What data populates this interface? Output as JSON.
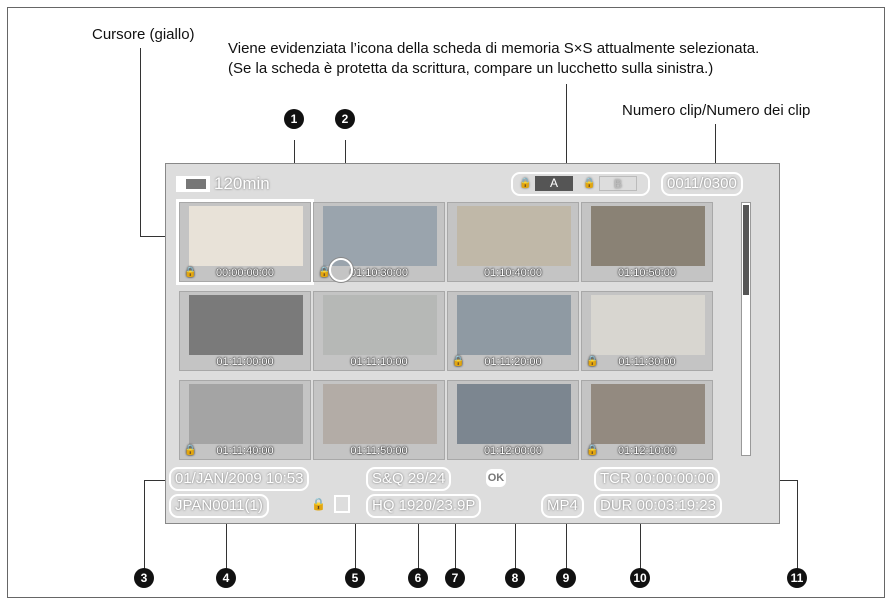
{
  "annotations": {
    "cursor": "Cursore (giallo)",
    "card_line1": "Viene evidenziata l’icona della scheda di memoria S×S attualmente selezionata.",
    "card_line2": "(Se la scheda è protetta da scrittura, compare un lucchetto sulla sinistra.)",
    "clip_count": "Numero clip/Numero dei clip"
  },
  "callouts": [
    "1",
    "2",
    "3",
    "4",
    "5",
    "6",
    "7",
    "8",
    "9",
    "10",
    "11"
  ],
  "screen": {
    "battery": "120min",
    "slot_a": "A",
    "slot_b": "B",
    "clip_counter": "0011/0300",
    "date": "01/JAN/2009 10:53",
    "clip_name": "JPAN0011(1)",
    "sq": "S&Q 29/24",
    "ok": "OK",
    "format": "HQ 1920/23.9P",
    "file_type": "MP4",
    "tcr": "TCR 00:00:00:00",
    "dur": "DUR 00:03:19:23"
  },
  "thumbnails": [
    {
      "tc": "00:00:00:00",
      "locked": true,
      "color": "#e8e2d8"
    },
    {
      "tc": "01:10:30:00",
      "locked": true,
      "color": "#9aa4ad"
    },
    {
      "tc": "01:10:40:00",
      "locked": false,
      "color": "#c0b8a8"
    },
    {
      "tc": "01:10:50:00",
      "locked": false,
      "color": "#8a8275"
    },
    {
      "tc": "01:11:00:00",
      "locked": false,
      "color": "#7a7a7a"
    },
    {
      "tc": "01:11:10:00",
      "locked": false,
      "color": "#b6b8b6"
    },
    {
      "tc": "01:11:20:00",
      "locked": true,
      "color": "#8f9aa3"
    },
    {
      "tc": "01:11:30:00",
      "locked": true,
      "color": "#d8d6d0"
    },
    {
      "tc": "01:11:40:00",
      "locked": true,
      "color": "#a4a4a4"
    },
    {
      "tc": "01:11:50:00",
      "locked": false,
      "color": "#b3aca6"
    },
    {
      "tc": "01:12:00:00",
      "locked": false,
      "color": "#7c8690"
    },
    {
      "tc": "01:12:10:00",
      "locked": true,
      "color": "#938a80"
    }
  ]
}
